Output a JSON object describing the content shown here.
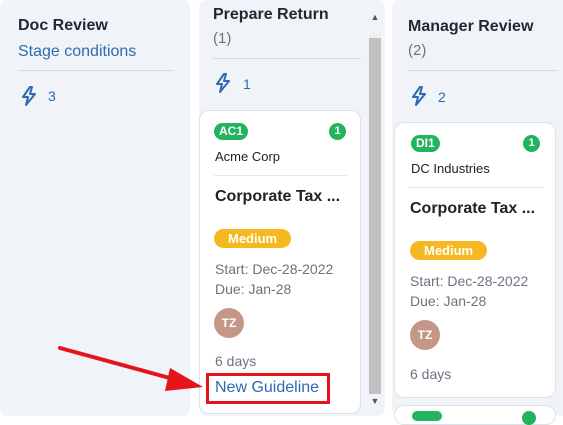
{
  "columns": [
    {
      "title": "Doc Review",
      "link": "Stage conditions",
      "automation_count": "3"
    },
    {
      "title": "Prepare Return",
      "count": "(1)",
      "automation_count": "1",
      "cards": [
        {
          "client_code": "AC1",
          "badge": "1",
          "client_name": "Acme Corp",
          "title": "Corporate Tax ...",
          "priority": "Medium",
          "start": "Start: Dec-28-2022",
          "due": "Due: Jan-28",
          "assignee_initials": "TZ",
          "days": "6 days",
          "guideline_link": "New Guideline"
        }
      ]
    },
    {
      "title": "Manager Review",
      "count": "(2)",
      "automation_count": "2",
      "cards": [
        {
          "client_code": "DI1",
          "badge": "1",
          "client_name": "DC Industries",
          "title": "Corporate Tax ...",
          "priority": "Medium",
          "start": "Start: Dec-28-2022",
          "due": "Due: Jan-28",
          "assignee_initials": "TZ",
          "days": "6 days"
        }
      ]
    }
  ],
  "icons": {
    "automation": "lightning-bolt-icon",
    "annotation_arrow": "red-arrow"
  },
  "colors": {
    "link": "#2f6bb0",
    "client_badge": "#22b35e",
    "priority_medium": "#f5b820",
    "avatar": "#c49786",
    "highlight": "#e5131a"
  }
}
